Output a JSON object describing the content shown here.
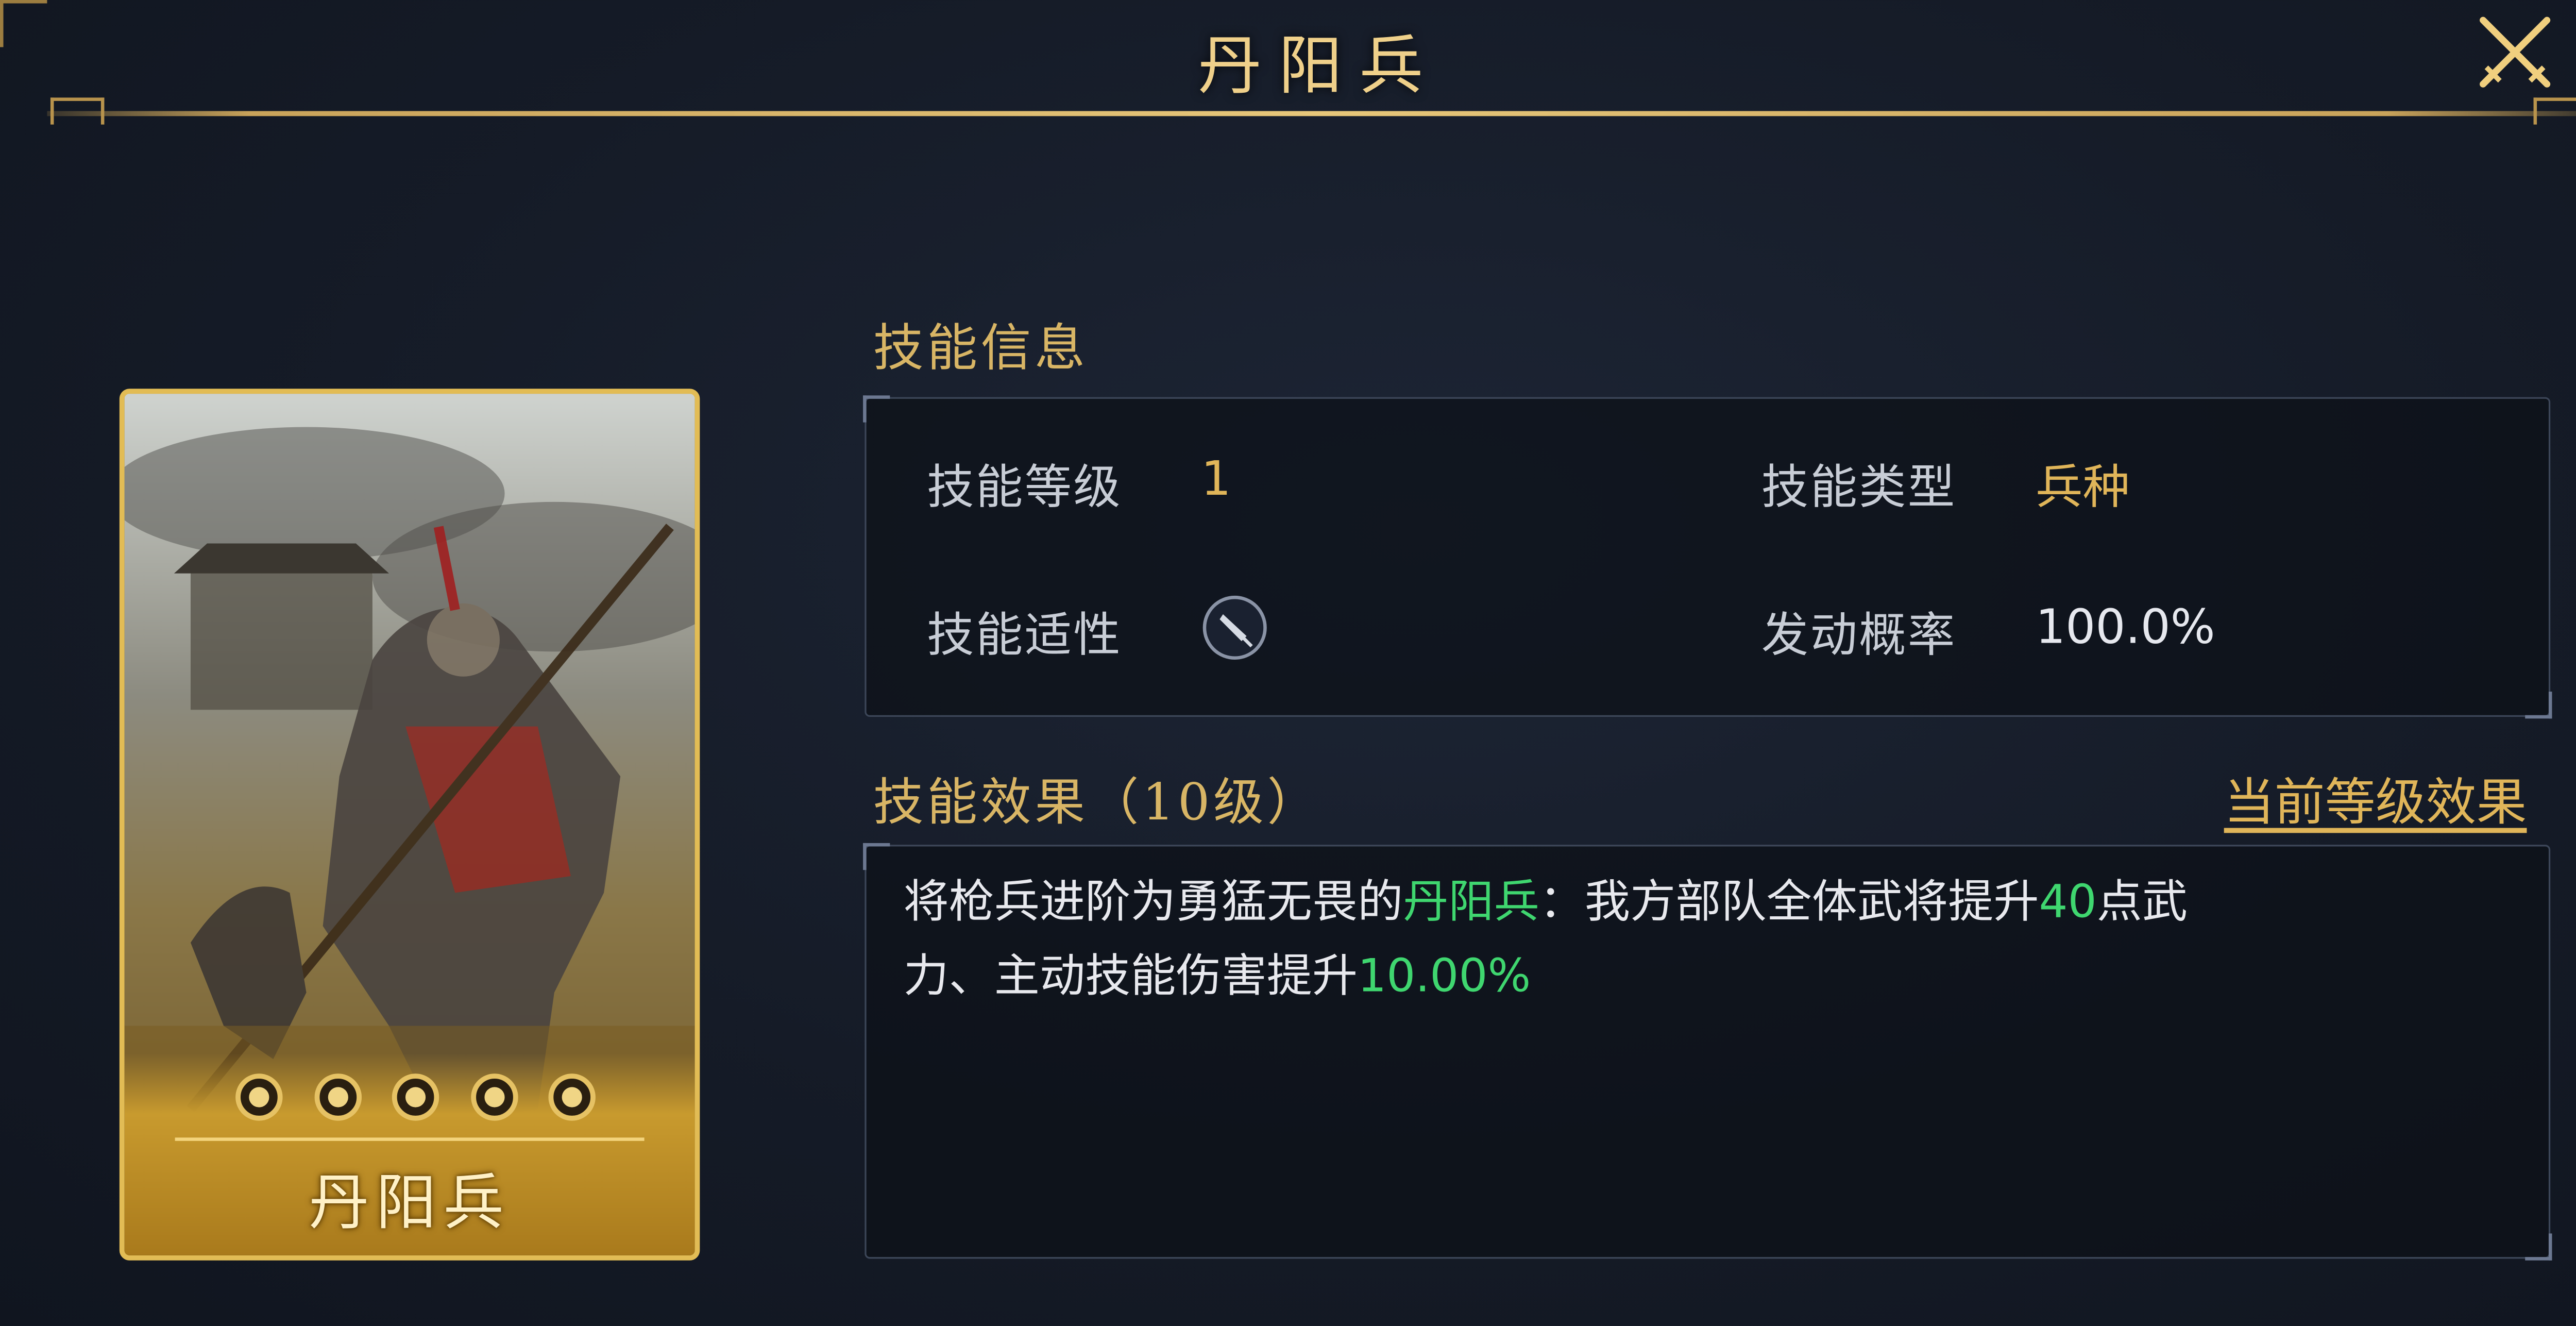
{
  "window": {
    "title": "丹阳兵"
  },
  "card": {
    "name": "丹阳兵",
    "pips": 5
  },
  "skill_info": {
    "section_title": "技能信息",
    "level_label": "技能等级",
    "level_value": "1",
    "type_label": "技能类型",
    "type_value": "兵种",
    "aptitude_label": "技能适性",
    "aptitude_icon": "spear-icon",
    "trigger_label": "发动概率",
    "trigger_value": "100.0%"
  },
  "skill_effect": {
    "section_title": "技能效果（10级）",
    "current_level_link": "当前等级效果",
    "text": {
      "p1": "将枪兵进阶为勇猛无畏的",
      "h1": "丹阳兵",
      "p2": "：我方部队全体武将提升",
      "h2": "40",
      "p3": "点武",
      "p4": "力、主动技能伤害提升",
      "h3": "10.00%"
    }
  },
  "colors": {
    "gold": "#d8b565",
    "highlight_green": "#3fd66f",
    "card_border": "#e2bc55"
  }
}
